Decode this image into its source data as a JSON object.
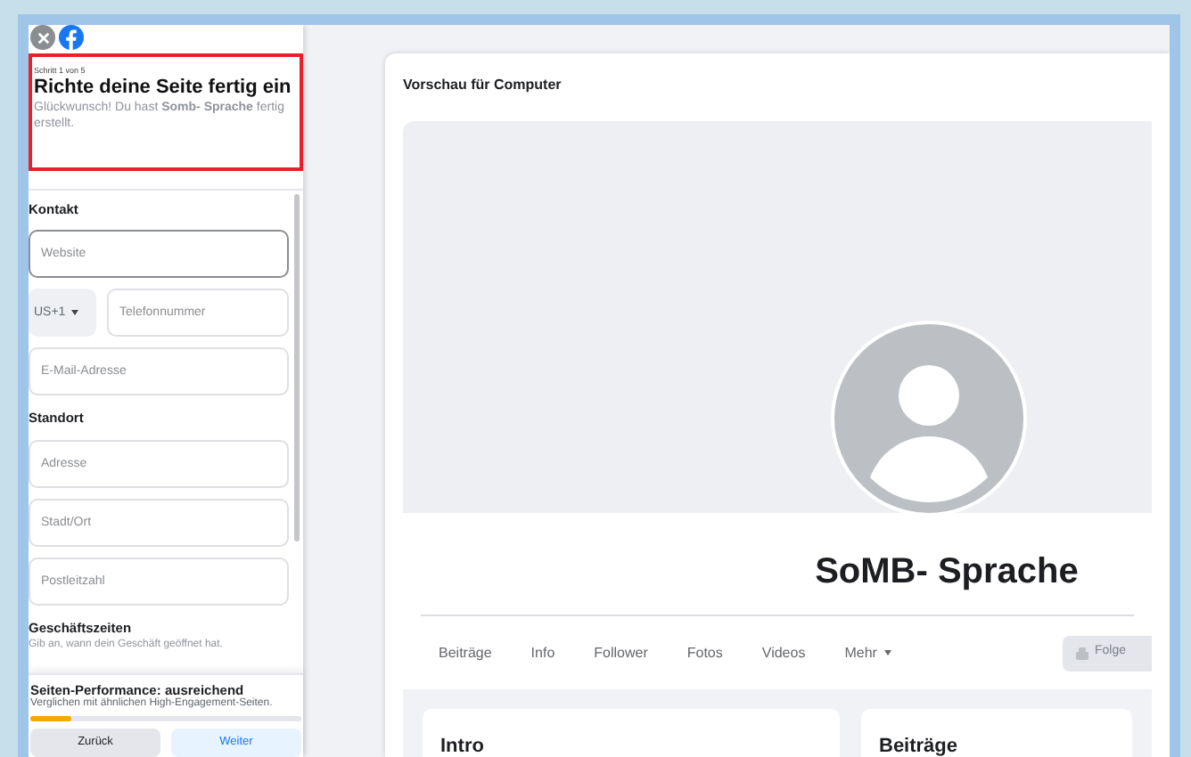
{
  "setup_panel": {
    "step": "Schritt 1 von 5",
    "title": "Richte deine Seite fertig ein",
    "message": "Glückwunsch! Du hast  **Somb- Sprache** fertig erstellt.",
    "sections": [
      {
        "heading": "Kontakt",
        "fields": [
          {
            "kind": "input",
            "placeholder": "Website",
            "focused": true
          },
          {
            "kind": "phone",
            "country": "US+1",
            "placeholder": "Telefonnummer",
            "focused": false
          },
          {
            "kind": "input",
            "placeholder": "E-Mail-Adresse",
            "focused": false
          }
        ]
      },
      {
        "heading": "Standort",
        "fields": [
          {
            "kind": "input",
            "placeholder": "Adresse",
            "focused": false
          },
          {
            "kind": "input",
            "placeholder": "Stadt/Ort",
            "focused": false
          },
          {
            "kind": "input",
            "placeholder": "Postleitzahl",
            "focused": false
          }
        ]
      },
      {
        "heading": "Geschäftszeiten",
        "hint": "Gib an, wann dein Geschäft geöffnet hat."
      }
    ],
    "performance": {
      "title": "Seiten-Performance: ausreichend",
      "description": "Verglichen mit ähnlichen High-Engagement-Seiten.",
      "level": 0.15
    },
    "buttons": [
      {
        "label": "Zurück",
        "kind": "secondary"
      },
      {
        "label": "Weiter",
        "kind": "primary"
      }
    ]
  },
  "preview": {
    "title": "Vorschau für Computer",
    "page_name": "SoMB- Sprache",
    "tabs": [
      {
        "label": "Beiträge",
        "dropdown": false
      },
      {
        "label": "Info",
        "dropdown": false
      },
      {
        "label": "Follower",
        "dropdown": false
      },
      {
        "label": "Fotos",
        "dropdown": false
      },
      {
        "label": "Videos",
        "dropdown": false
      },
      {
        "label": "Mehr",
        "dropdown": true
      }
    ],
    "follow_button": "Folge",
    "cards": [
      "Intro",
      "Beiträge"
    ]
  }
}
